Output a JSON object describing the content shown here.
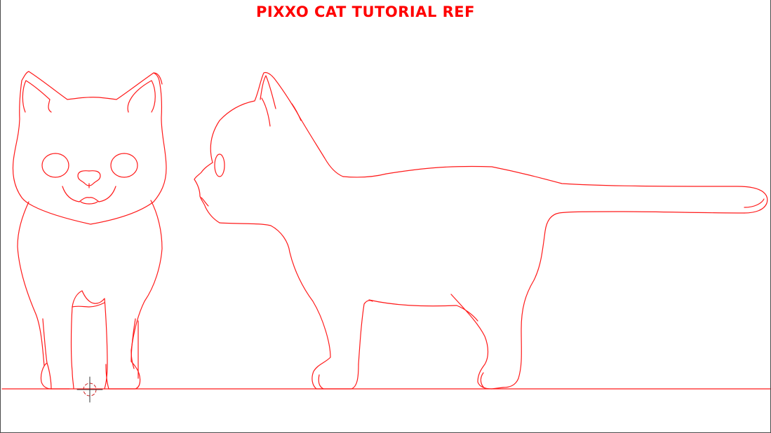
{
  "title": "PIXXO CAT TUTORIAL REF",
  "colors": {
    "line": "#ff1a1a",
    "title": "#ff0000",
    "cursor_dark": "#333333",
    "cursor_ring": "#cc2222",
    "background": "#ffffff"
  },
  "objects": [
    {
      "name": "cat-front-view",
      "kind": "line-art"
    },
    {
      "name": "cat-side-view",
      "kind": "line-art"
    },
    {
      "name": "ground-line",
      "kind": "guide"
    },
    {
      "name": "3d-cursor-icon",
      "kind": "cursor"
    }
  ]
}
